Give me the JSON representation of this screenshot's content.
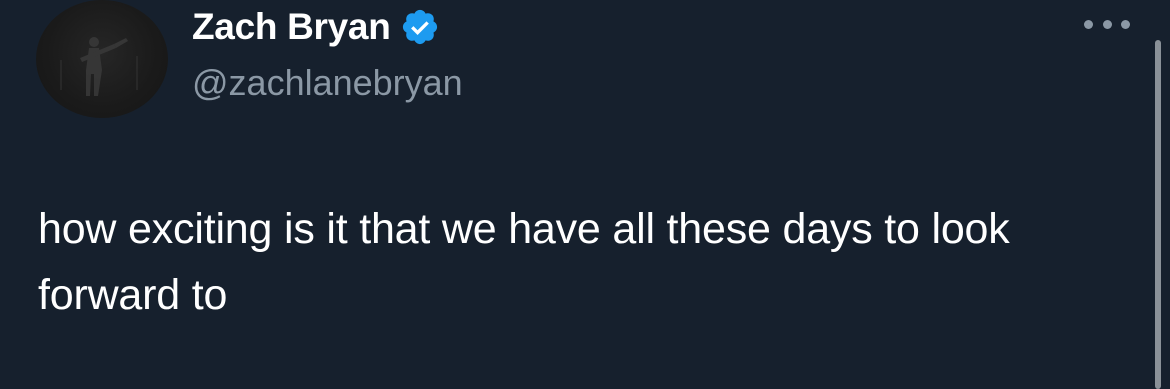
{
  "author": {
    "display_name": "Zach Bryan",
    "handle": "@zachlanebryan",
    "verified": true,
    "verified_badge_color": "#1d9bf0",
    "avatar_icon": "profile-photo-silhouette-guitarist"
  },
  "tweet": {
    "text": "how exciting is it that we have all these days to look forward to"
  },
  "menu": {
    "icon": "more-horizontal-icon"
  },
  "colors": {
    "background": "#16202d",
    "primary_text": "#ffffff",
    "secondary_text": "#8b98a5"
  }
}
